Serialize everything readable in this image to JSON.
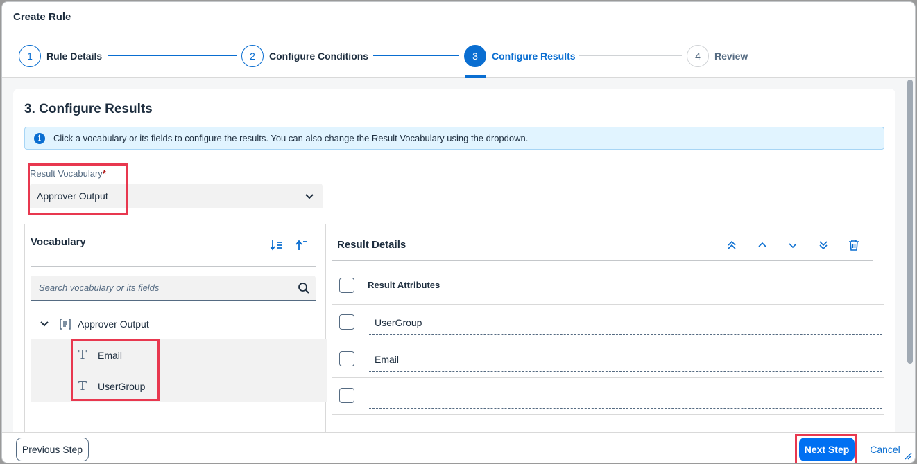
{
  "dialog": {
    "title": "Create Rule"
  },
  "wizard": {
    "steps": [
      {
        "number": "1",
        "label": "Rule Details"
      },
      {
        "number": "2",
        "label": "Configure Conditions"
      },
      {
        "number": "3",
        "label": "Configure Results"
      },
      {
        "number": "4",
        "label": "Review"
      }
    ],
    "active_step": 3
  },
  "section": {
    "title": "3. Configure Results",
    "info_message": "Click a vocabulary or its fields to configure the results. You can also change the Result Vocabulary using the dropdown."
  },
  "result_vocabulary": {
    "label": "Result Vocabulary",
    "required_marker": "*",
    "value": "Approver Output"
  },
  "vocabulary_panel": {
    "title": "Vocabulary",
    "search_placeholder": "Search vocabulary or its fields",
    "tree": {
      "root": "Approver Output",
      "fields": [
        "Email",
        "UserGroup"
      ]
    }
  },
  "result_panel": {
    "title": "Result Details",
    "column_header": "Result Attributes",
    "rows": [
      "UserGroup",
      "Email",
      ""
    ]
  },
  "footer": {
    "previous_label": "Previous Step",
    "next_label": "Next Step",
    "cancel_label": "Cancel"
  },
  "colors": {
    "accent": "#0a6ed1",
    "primary_button": "#0070f2",
    "highlight": "#e8384f",
    "info_bg": "#e1f4ff"
  }
}
